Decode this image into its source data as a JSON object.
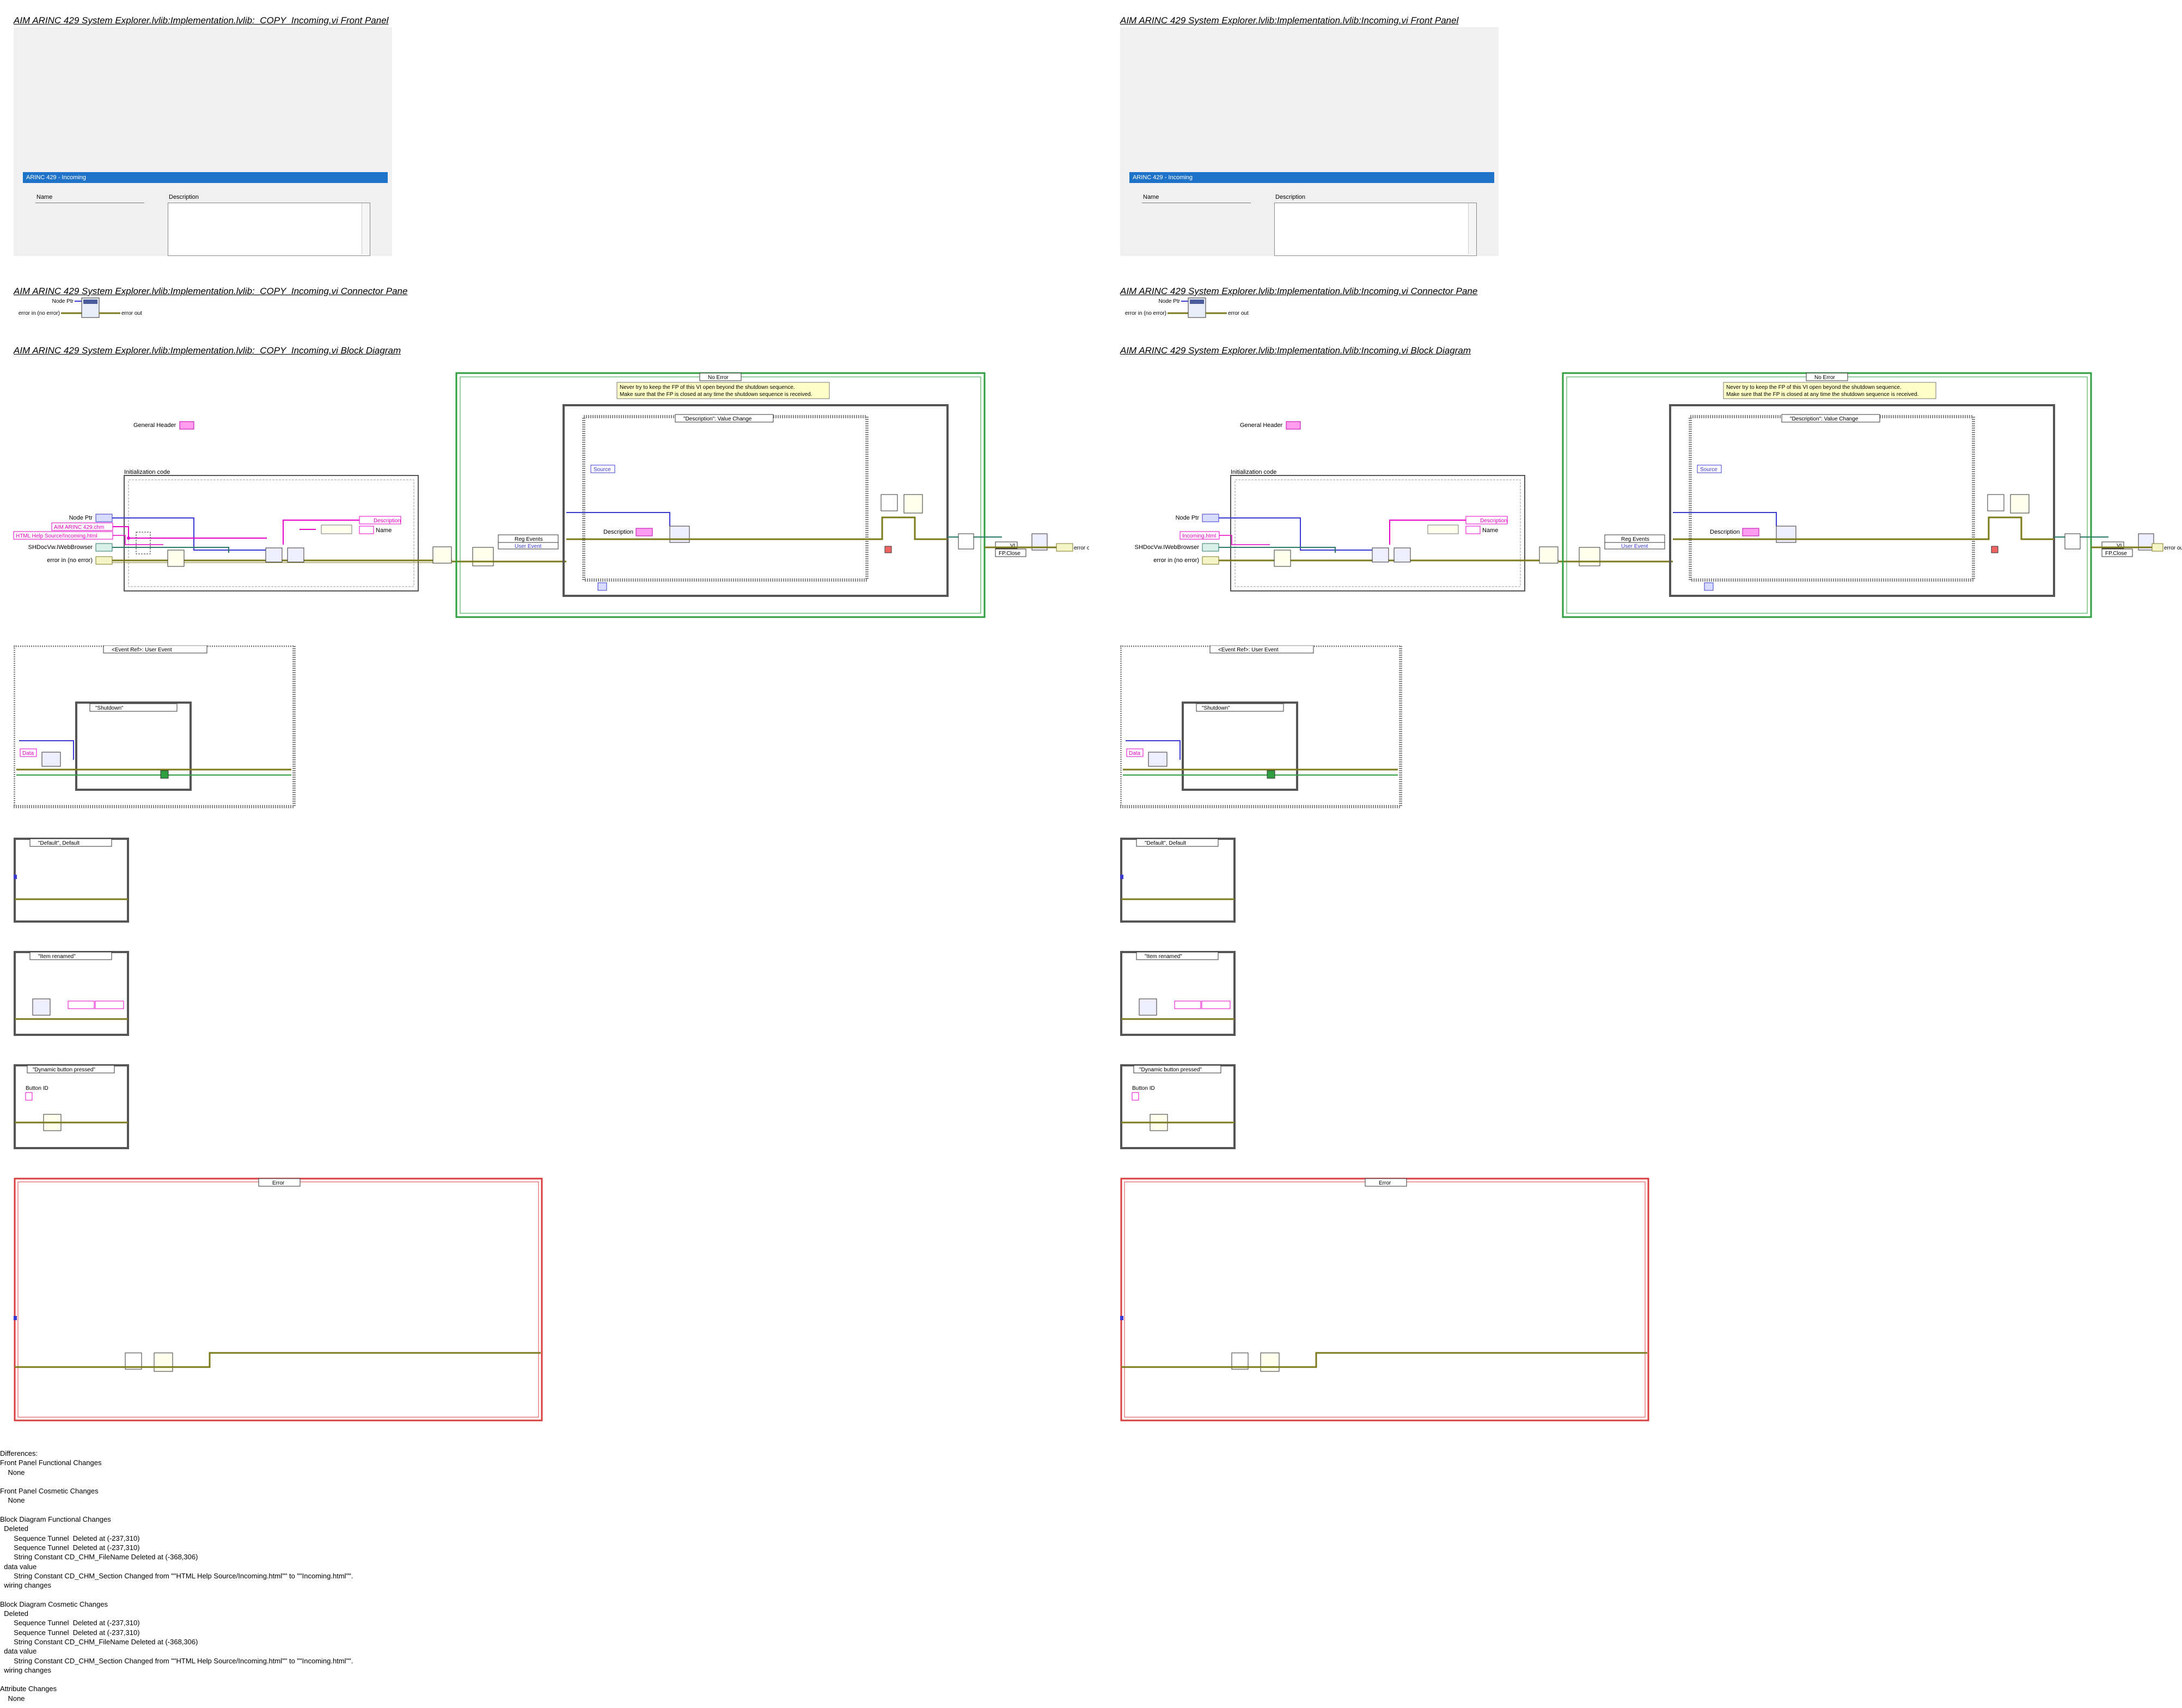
{
  "left": {
    "fp_title": "AIM ARINC 429 System Explorer.lvlib:Implementation.lvlib:_COPY_Incoming.vi Front Panel",
    "cp_title": "AIM ARINC 429 System Explorer.lvlib:Implementation.lvlib:_COPY_Incoming.vi Connector Pane",
    "bd_title": "AIM ARINC 429 System Explorer.lvlib:Implementation.lvlib:_COPY_Incoming.vi Block Diagram",
    "diagram": {
      "node_ptr_label": "Node Ptr",
      "const_1": "AIM ARINC 429.chm",
      "const_2": "HTML Help Source/Incoming.html",
      "browser_label": "SHDocVw.IWebBrowser",
      "error_in_label": "error in (no error)"
    }
  },
  "right": {
    "fp_title": "AIM ARINC 429 System Explorer.lvlib:Implementation.lvlib:Incoming.vi Front Panel",
    "cp_title": "AIM ARINC 429 System Explorer.lvlib:Implementation.lvlib:Incoming.vi Connector Pane",
    "bd_title": "AIM ARINC 429 System Explorer.lvlib:Implementation.lvlib:Incoming.vi Block Diagram",
    "diagram": {
      "node_ptr_label": "Node Ptr",
      "const_1": "Incoming.html",
      "browser_label": "SHDocVw.IWebBrowser",
      "error_in_label": "error in (no error)"
    }
  },
  "front_panel": {
    "bar_label": "ARINC 429 - Incoming",
    "name_label": "Name",
    "description_label": "Description"
  },
  "connector": {
    "node_ptr": "Node Ptr",
    "error_in": "error in (no error)",
    "error_out": "error out"
  },
  "diagram_common": {
    "general_header": "General Header",
    "init_code": "Initialization code",
    "no_error_case": "No Error",
    "note_line1": "Never try to keep the FP of this VI open beyond the shutdown sequence.",
    "note_line2": "Make sure that the FP is closed at any time the shutdown sequence is received.",
    "event_desc_value_change": "\"Description\": Value Change",
    "source_label": "Source",
    "description_label": "Description",
    "name_label": "Name",
    "reg_events": "Reg Events",
    "user_event": "User Event",
    "vi_label": "VI",
    "fp_close": "FP.Close",
    "error_out": "error out",
    "event_ref_user_event": "<Event Ref>: User Event",
    "data_label": "Data",
    "shutdown_case": "\"Shutdown\"",
    "default_case": "\"Default\", Default",
    "item_renamed_case": "\"Item renamed\"",
    "dynamic_button_case": "\"Dynamic button pressed\"",
    "button_id_label": "Button ID",
    "error_case": "Error"
  },
  "differences_text": [
    "Differences:",
    "Front Panel Functional Changes",
    "    None",
    "",
    "Front Panel Cosmetic Changes",
    "    None",
    "",
    "Block Diagram Functional Changes",
    "  Deleted",
    "       Sequence Tunnel  Deleted at (-237,310)",
    "       Sequence Tunnel  Deleted at (-237,310)",
    "       String Constant CD_CHM_FileName Deleted at (-368,306)",
    "  data value",
    "       String Constant CD_CHM_Section Changed from \"\"HTML Help Source/Incoming.html\"\" to \"\"Incoming.html\"\".",
    "  wiring changes",
    "",
    "Block Diagram Cosmetic Changes",
    "  Deleted",
    "       Sequence Tunnel  Deleted at (-237,310)",
    "       Sequence Tunnel  Deleted at (-237,310)",
    "       String Constant CD_CHM_FileName Deleted at (-368,306)",
    "  data value",
    "       String Constant CD_CHM_Section Changed from \"\"HTML Help Source/Incoming.html\"\" to \"\"Incoming.html\"\".",
    "  wiring changes",
    "",
    "Attribute Changes",
    "    None"
  ],
  "colors": {
    "fp_bar": "#1e73c8",
    "error_wire": "#7a7a1a",
    "ref_wire": "#3a3ad0",
    "string_wire": "#e600c8",
    "loop_green": "#2e9e3e",
    "error_case_red": "#d84040"
  }
}
